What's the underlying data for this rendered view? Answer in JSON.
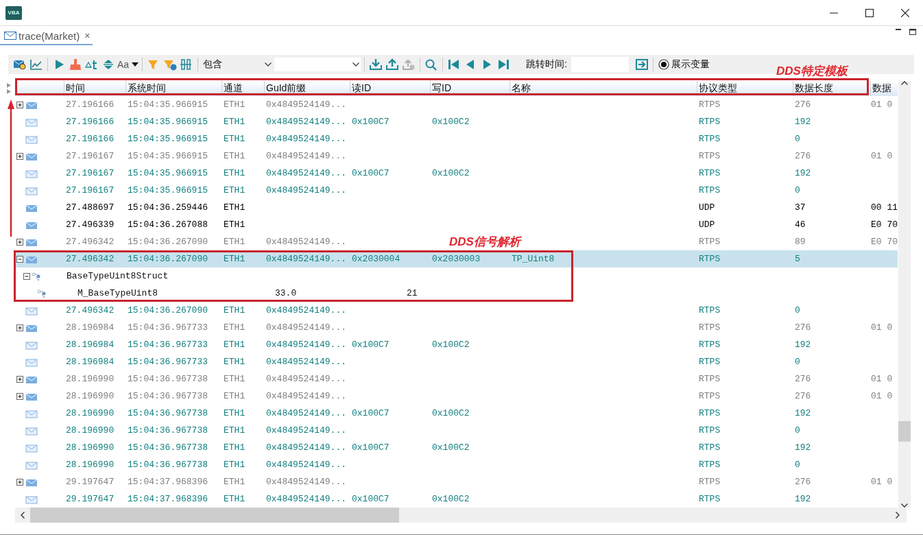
{
  "window": {
    "logo": "VBA"
  },
  "tab": {
    "label": "trace(Market)",
    "close_glyph": "×",
    "selected": true
  },
  "toolbar": {
    "font_button": "Aa",
    "filter_mode": "包含",
    "jump_label": "跳转时间:",
    "show_variables": {
      "label": "展示变量",
      "checked": true
    }
  },
  "table": {
    "columns": [
      "时间",
      "系统时间",
      "通道",
      "GuId前缀",
      "读ID",
      "写ID",
      "名称",
      "协议类型",
      "数据长度",
      "数据"
    ],
    "rows": [
      {
        "kind": "collapsed",
        "selected": false,
        "color": "#808080",
        "cells": {
          "time": "27.196166",
          "system_time": "15:04:35.966915",
          "channel": "ETH1",
          "guid_prefix": "0x4849524149...",
          "protocol": "RTPS",
          "length": "276",
          "data": "01 0"
        }
      },
      {
        "kind": "leaf",
        "selected": false,
        "color": "#138080",
        "cells": {
          "time": "27.196166",
          "system_time": "15:04:35.966915",
          "channel": "ETH1",
          "guid_prefix": "0x4849524149...",
          "read_id": "0x100C7",
          "write_id": "0x100C2",
          "protocol": "RTPS",
          "length": "192"
        }
      },
      {
        "kind": "leaf",
        "selected": false,
        "color": "#138080",
        "cells": {
          "time": "27.196166",
          "system_time": "15:04:35.966915",
          "channel": "ETH1",
          "guid_prefix": "0x4849524149...",
          "protocol": "RTPS",
          "length": "0"
        }
      },
      {
        "kind": "collapsed",
        "selected": false,
        "color": "#808080",
        "cells": {
          "time": "27.196167",
          "system_time": "15:04:35.966915",
          "channel": "ETH1",
          "guid_prefix": "0x4849524149...",
          "protocol": "RTPS",
          "length": "276",
          "data": "01 0"
        }
      },
      {
        "kind": "leaf",
        "selected": false,
        "color": "#138080",
        "cells": {
          "time": "27.196167",
          "system_time": "15:04:35.966915",
          "channel": "ETH1",
          "guid_prefix": "0x4849524149...",
          "read_id": "0x100C7",
          "write_id": "0x100C2",
          "protocol": "RTPS",
          "length": "192"
        }
      },
      {
        "kind": "leaf",
        "selected": false,
        "color": "#138080",
        "cells": {
          "time": "27.196167",
          "system_time": "15:04:35.966915",
          "channel": "ETH1",
          "guid_prefix": "0x4849524149...",
          "protocol": "RTPS",
          "length": "0"
        }
      },
      {
        "kind": "plain",
        "selected": false,
        "color": "#000000",
        "cells": {
          "time": "27.488697",
          "system_time": "15:04:36.259446",
          "channel": "ETH1",
          "protocol": "UDP",
          "length": "37",
          "data": "00 11"
        }
      },
      {
        "kind": "plain",
        "selected": false,
        "color": "#000000",
        "cells": {
          "time": "27.496339",
          "system_time": "15:04:36.267088",
          "channel": "ETH1",
          "protocol": "UDP",
          "length": "46",
          "data": "E0 70"
        }
      },
      {
        "kind": "collapsed",
        "selected": false,
        "color": "#808080",
        "cells": {
          "time": "27.496342",
          "system_time": "15:04:36.267090",
          "channel": "ETH1",
          "guid_prefix": "0x4849524149...",
          "protocol": "RTPS",
          "length": "89",
          "data": "E0 70"
        }
      },
      {
        "kind": "expanded",
        "selected": true,
        "color": "#138080",
        "cells": {
          "time": "27.496342",
          "system_time": "15:04:36.267090",
          "channel": "ETH1",
          "guid_prefix": "0x4849524149...",
          "read_id": "0x2030004",
          "write_id": "0x2030003",
          "name": "TP_Uint8",
          "protocol": "RTPS",
          "length": "5"
        },
        "children": [
          {
            "name": "BaseTypeUint8Struct",
            "expanded": true,
            "children": [
              {
                "name": "M_BaseTypeUint8",
                "values": [
                  "33.0",
                  "21"
                ]
              }
            ]
          }
        ]
      },
      {
        "kind": "leaf",
        "selected": false,
        "color": "#138080",
        "cells": {
          "time": "27.496342",
          "system_time": "15:04:36.267090",
          "channel": "ETH1",
          "guid_prefix": "0x4849524149...",
          "protocol": "RTPS",
          "length": "0"
        }
      },
      {
        "kind": "collapsed",
        "selected": false,
        "color": "#808080",
        "cells": {
          "time": "28.196984",
          "system_time": "15:04:36.967733",
          "channel": "ETH1",
          "guid_prefix": "0x4849524149...",
          "protocol": "RTPS",
          "length": "276",
          "data": "01 0"
        }
      },
      {
        "kind": "leaf",
        "selected": false,
        "color": "#138080",
        "cells": {
          "time": "28.196984",
          "system_time": "15:04:36.967733",
          "channel": "ETH1",
          "guid_prefix": "0x4849524149...",
          "read_id": "0x100C7",
          "write_id": "0x100C2",
          "protocol": "RTPS",
          "length": "192"
        }
      },
      {
        "kind": "leaf",
        "selected": false,
        "color": "#138080",
        "cells": {
          "time": "28.196984",
          "system_time": "15:04:36.967733",
          "channel": "ETH1",
          "guid_prefix": "0x4849524149...",
          "protocol": "RTPS",
          "length": "0"
        }
      },
      {
        "kind": "collapsed",
        "selected": false,
        "color": "#808080",
        "cells": {
          "time": "28.196990",
          "system_time": "15:04:36.967738",
          "channel": "ETH1",
          "guid_prefix": "0x4849524149...",
          "protocol": "RTPS",
          "length": "276",
          "data": "01 0"
        }
      },
      {
        "kind": "collapsed",
        "selected": false,
        "color": "#808080",
        "cells": {
          "time": "28.196990",
          "system_time": "15:04:36.967738",
          "channel": "ETH1",
          "guid_prefix": "0x4849524149...",
          "protocol": "RTPS",
          "length": "276",
          "data": "01 0"
        }
      },
      {
        "kind": "leaf",
        "selected": false,
        "color": "#138080",
        "cells": {
          "time": "28.196990",
          "system_time": "15:04:36.967738",
          "channel": "ETH1",
          "guid_prefix": "0x4849524149...",
          "read_id": "0x100C7",
          "write_id": "0x100C2",
          "protocol": "RTPS",
          "length": "192"
        }
      },
      {
        "kind": "leaf",
        "selected": false,
        "color": "#138080",
        "cells": {
          "time": "28.196990",
          "system_time": "15:04:36.967738",
          "channel": "ETH1",
          "guid_prefix": "0x4849524149...",
          "protocol": "RTPS",
          "length": "0"
        }
      },
      {
        "kind": "leaf",
        "selected": false,
        "color": "#138080",
        "cells": {
          "time": "28.196990",
          "system_time": "15:04:36.967738",
          "channel": "ETH1",
          "guid_prefix": "0x4849524149...",
          "read_id": "0x100C7",
          "write_id": "0x100C2",
          "protocol": "RTPS",
          "length": "192"
        }
      },
      {
        "kind": "leaf",
        "selected": false,
        "color": "#138080",
        "cells": {
          "time": "28.196990",
          "system_time": "15:04:36.967738",
          "channel": "ETH1",
          "guid_prefix": "0x4849524149...",
          "protocol": "RTPS",
          "length": "0"
        }
      },
      {
        "kind": "collapsed",
        "selected": false,
        "color": "#808080",
        "cells": {
          "time": "29.197647",
          "system_time": "15:04:37.968396",
          "channel": "ETH1",
          "guid_prefix": "0x4849524149...",
          "protocol": "RTPS",
          "length": "276",
          "data": "01 0"
        }
      },
      {
        "kind": "leaf",
        "selected": false,
        "color": "#138080",
        "cells": {
          "time": "29.197647",
          "system_time": "15:04:37.968396",
          "channel": "ETH1",
          "guid_prefix": "0x4849524149...",
          "read_id": "0x100C7",
          "write_id": "0x100C2",
          "protocol": "RTPS",
          "length": "192"
        }
      }
    ]
  },
  "annotations": [
    {
      "text": "DDS特定模板"
    },
    {
      "text": "DDS信号解析"
    }
  ]
}
